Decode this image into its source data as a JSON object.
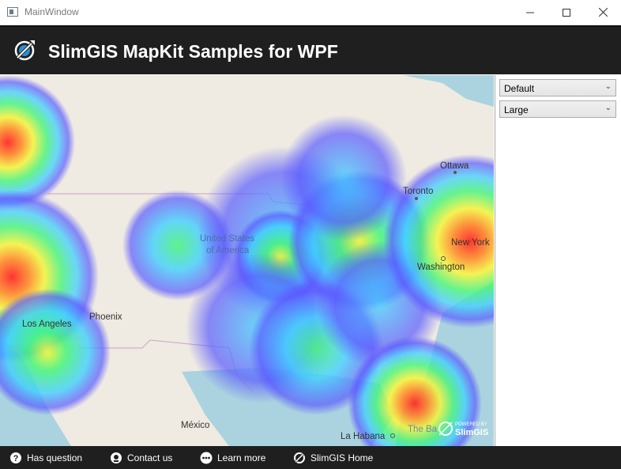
{
  "window": {
    "title": "MainWindow",
    "controls": [
      "minimize-icon",
      "maximize-icon",
      "close-icon"
    ]
  },
  "header": {
    "title": "SlimGIS MapKit Samples for WPF",
    "logo_icon": "slimgis-logo-icon"
  },
  "map": {
    "labels": {
      "ottawa": "Ottawa",
      "toronto": "Toronto",
      "united_states_line1": "United States",
      "united_states_line2": "of America",
      "new_york": "New York",
      "washington": "Washington",
      "phoenix": "Phoenix",
      "los_angeles": "Los Angeles",
      "mexico": "México",
      "la_habana": "La Habana",
      "bahamas": "The Ba"
    },
    "watermark": {
      "powered_by": "POWERED BY",
      "brand": "SlimGIS"
    }
  },
  "sidebar": {
    "style_select": {
      "value": "Default"
    },
    "size_select": {
      "value": "Large"
    }
  },
  "footer": {
    "links": [
      {
        "label": "Has question",
        "icon": "question-icon"
      },
      {
        "label": "Contact us",
        "icon": "headset-icon"
      },
      {
        "label": "Learn more",
        "icon": "more-icon"
      },
      {
        "label": "SlimGIS Home",
        "icon": "slimgis-logo-icon"
      }
    ]
  },
  "colors": {
    "header_bg": "#1f1f1f",
    "map_land": "#efeae2",
    "map_water": "#aad3df",
    "heat_low": "#5a5aff",
    "heat_mid": "#3cff6a",
    "heat_high": "#ff2a2a"
  }
}
